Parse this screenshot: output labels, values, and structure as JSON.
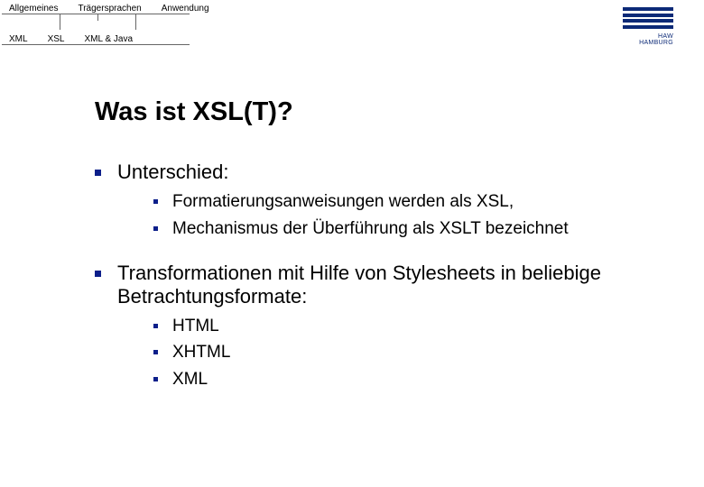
{
  "nav": {
    "row1": [
      "Allgemeines",
      "Trägersprachen",
      "Anwendung"
    ],
    "row2": [
      "XML",
      "XSL",
      "XML & Java"
    ]
  },
  "logo_text": "HAW HAMBURG",
  "title": "Was ist XSL(T)?",
  "bullets": [
    {
      "text": "Unterschied:",
      "children": [
        "Formatierungsanweisungen werden als XSL,",
        "Mechanismus der Überführung als XSLT bezeichnet"
      ]
    },
    {
      "text": "Transformationen mit Hilfe von Stylesheets in beliebige Betrachtungsformate:",
      "children": [
        "HTML",
        "XHTML",
        "XML"
      ]
    }
  ]
}
